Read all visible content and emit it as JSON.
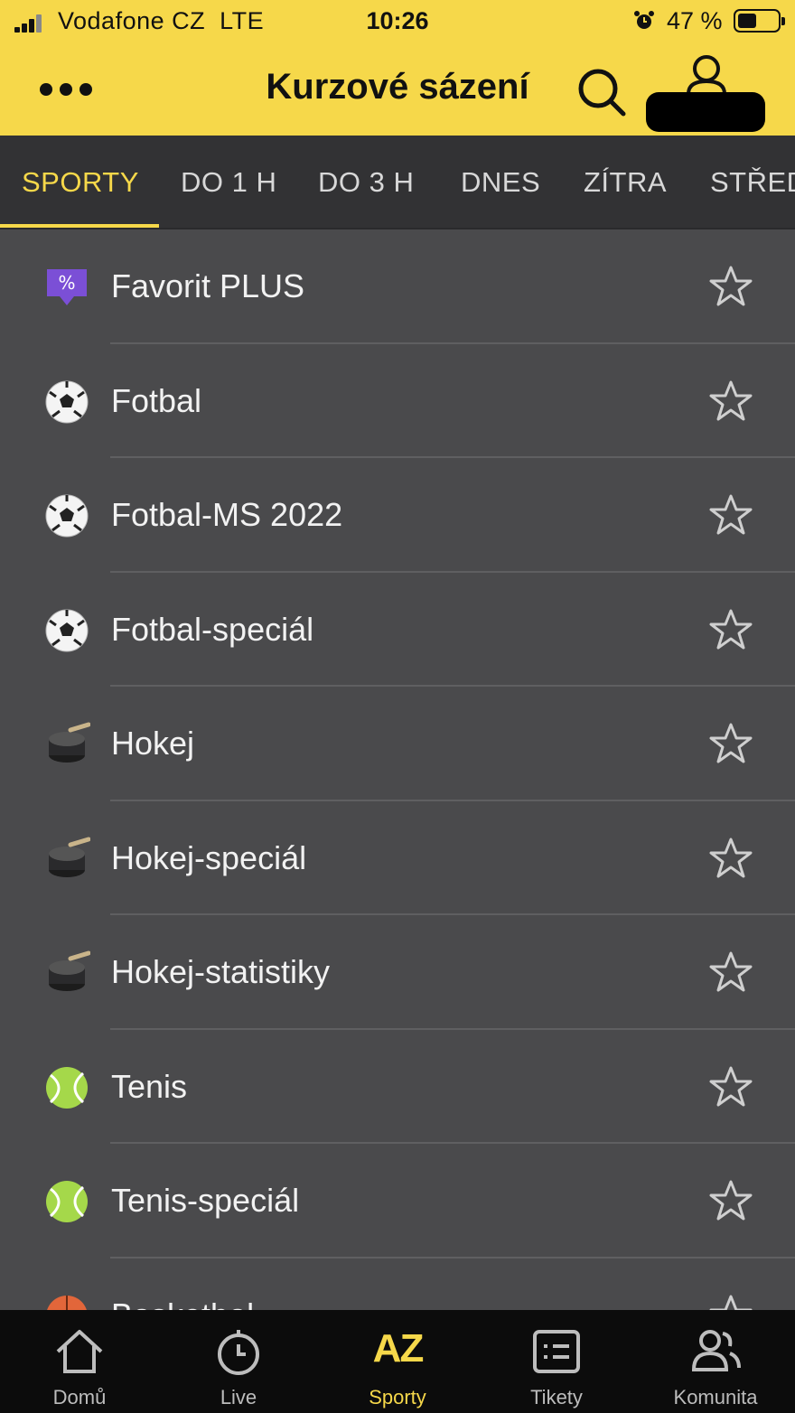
{
  "status_bar": {
    "carrier": "Vodafone CZ",
    "network": "LTE",
    "time": "10:26",
    "battery": "47 %"
  },
  "header": {
    "title": "Kurzové sázení",
    "menu_icon": "more-dots-icon",
    "search_icon": "search-icon",
    "account_icon": "user-icon"
  },
  "tabs": [
    {
      "label": "SPORTY",
      "active": true
    },
    {
      "label": "DO 1 H"
    },
    {
      "label": "DO 3 H"
    },
    {
      "label": "DNES"
    },
    {
      "label": "ZÍTRA"
    },
    {
      "label": "STŘED"
    }
  ],
  "sports": [
    {
      "label": "Favorit PLUS",
      "icon": "favorit-plus-icon"
    },
    {
      "label": "Fotbal",
      "icon": "soccer-ball-icon"
    },
    {
      "label": "Fotbal-MS 2022",
      "icon": "soccer-ball-icon"
    },
    {
      "label": "Fotbal-speciál",
      "icon": "soccer-ball-icon"
    },
    {
      "label": "Hokej",
      "icon": "hockey-icon"
    },
    {
      "label": "Hokej-speciál",
      "icon": "hockey-icon"
    },
    {
      "label": "Hokej-statistiky",
      "icon": "hockey-icon"
    },
    {
      "label": "Tenis",
      "icon": "tennis-ball-icon"
    },
    {
      "label": "Tenis-speciál",
      "icon": "tennis-ball-icon"
    },
    {
      "label": "Basketbal",
      "icon": "basketball-icon"
    }
  ],
  "bottom_nav": [
    {
      "label": "Domů",
      "icon": "home-icon"
    },
    {
      "label": "Live",
      "icon": "stopwatch-icon"
    },
    {
      "label": "Sporty",
      "icon": "az-icon",
      "icon_text": "AZ",
      "active": true
    },
    {
      "label": "Tikety",
      "icon": "ticket-list-icon"
    },
    {
      "label": "Komunita",
      "icon": "community-icon"
    }
  ],
  "colors": {
    "accent": "#f6d84a",
    "background": "#4a4a4c",
    "tab_bar": "#323234",
    "nav_bar": "#0c0c0c"
  }
}
